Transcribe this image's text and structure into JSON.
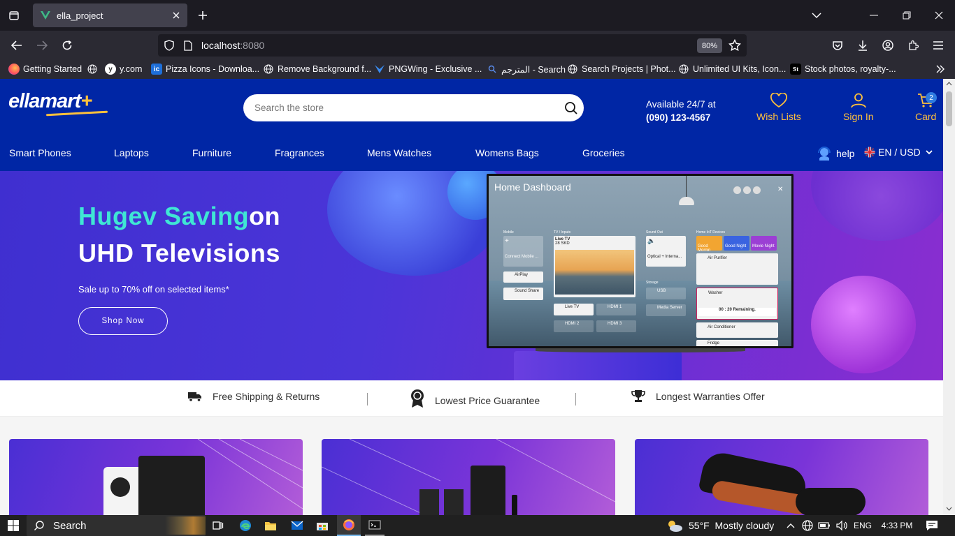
{
  "browser": {
    "tab_title": "ella_project",
    "url_host": "localhost",
    "url_port": ":8080",
    "zoom": "80%",
    "bookmarks": [
      {
        "label": "Getting Started"
      },
      {
        "label": "y.com"
      },
      {
        "label": "Pizza Icons - Downloa..."
      },
      {
        "label": "Remove Background f..."
      },
      {
        "label": "PNGWing - Exclusive ..."
      },
      {
        "label": "المترجم - Search"
      },
      {
        "label": "Search Projects | Phot..."
      },
      {
        "label": "Unlimited UI Kits, Icon..."
      },
      {
        "label": "Stock photos, royalty-..."
      }
    ]
  },
  "header": {
    "logo_main": "ellamart",
    "logo_plus": "+",
    "search_placeholder": "Search the store",
    "availability": "Available 24/7 at",
    "phone": "(090) 123-4567",
    "wishlist": "Wish Lists",
    "signin": "Sign In",
    "cart": "Card",
    "cart_count": "2",
    "categories": [
      "Smart Phones",
      "Laptops",
      "Furniture",
      "Fragrances",
      "Mens Watches",
      "Womens Bags",
      "Groceries"
    ],
    "help": "help",
    "language": "EN / USD"
  },
  "hero": {
    "title_accent": "Hugev Saving",
    "title_rest": "on",
    "title_line2": "UHD Televisions",
    "subtitle": "Sale up to 70% off on selected items*",
    "button": "Shop Now",
    "tv": {
      "title": "Home Dashboard",
      "sections": [
        "Mobile",
        "TV / Inputs",
        "Sound Out",
        "Home IoT Devices",
        "Storage"
      ],
      "cards": {
        "connect_mobile": "Connect Mobile ...",
        "airplay": "AirPlay",
        "sound_share": "Sound Share",
        "live_tv": "Live TV",
        "channel": "28 SKD",
        "hdmi1": "HDMI 1",
        "hdmi2": "HDMI 2",
        "hdmi3": "HDMI 3",
        "optical": "Optical + Interna...",
        "usb": "USB",
        "media_server": "Media Server",
        "good_morning": "Good Mornin",
        "good_night": "Good Night",
        "movie_night": "Movie Night",
        "air_purifier": "Air Purifier",
        "washer": "Washer",
        "washer_time": "00 : 20 Remaining.",
        "air_conditioner": "Air Conditioner",
        "fridge": "Fridge"
      }
    }
  },
  "features": [
    {
      "label": "Free Shipping & Returns",
      "icon": "truck-icon"
    },
    {
      "label": "Lowest Price Guarantee",
      "icon": "award-icon"
    },
    {
      "label": "Longest Warranties Offer",
      "icon": "trophy-icon"
    }
  ],
  "taskbar": {
    "search": "Search",
    "weather": "55°F  Mostly cloudy",
    "lang": "ENG",
    "time": "4:33 PM"
  }
}
